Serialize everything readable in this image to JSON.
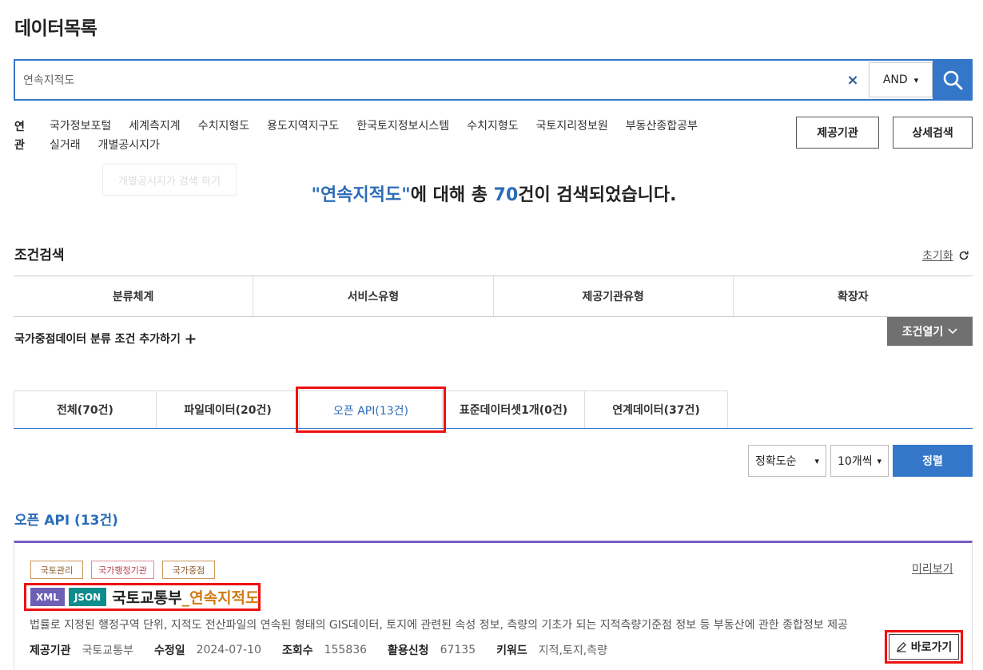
{
  "page": {
    "title": "데이터목록"
  },
  "search": {
    "value": "연속지적도",
    "clear_icon": "×",
    "operator": "AND"
  },
  "related": {
    "label": "연관",
    "items": [
      "국가정보포털",
      "세계측지계",
      "수치지형도",
      "용도지역지구도",
      "한국토지정보시스템",
      "수치지형도",
      "국토지리정보원",
      "부동산종합공부",
      "실거래",
      "개별공시지가"
    ],
    "tooltip": "개별공시지가 검색 하기"
  },
  "buttons": {
    "provider": "제공기관",
    "detail_search": "상세검색"
  },
  "result": {
    "open_quote": "\"",
    "keyword": "연속지적도",
    "close_quote": "\"",
    "mid": "에 대해 총 ",
    "count": "70",
    "suffix": "건이 검색되었습니다."
  },
  "conditions": {
    "title": "조건검색",
    "reset": "초기화",
    "columns": [
      "분류체계",
      "서비스유형",
      "제공기관유형",
      "확장자"
    ],
    "add_label": "국가중점데이터 분류 조건 추가하기",
    "open_label": "조건열기"
  },
  "tabs": [
    {
      "label": "전체(70건)"
    },
    {
      "label": "파일데이터(20건)"
    },
    {
      "label": "오픈 API(13건)"
    },
    {
      "label": "표준데이터셋1개(0건)"
    },
    {
      "label": "연계데이터(37건)"
    }
  ],
  "sort": {
    "order": "정확도순",
    "per_page": "10개씩",
    "button": "정렬"
  },
  "section": {
    "title": "오픈 API (13건)"
  },
  "item": {
    "tags": [
      "국토관리",
      "국가행정기관",
      "국가중점"
    ],
    "preview": "미리보기",
    "formats": [
      "XML",
      "JSON"
    ],
    "title_org": "국토교통부",
    "title_sep": "_",
    "title_name": "연속지적도",
    "description": "법률로 지정된 행정구역 단위, 지적도 전산파일의 연속된 형태의 GIS데이터, 토지에 관련된 속성 정보, 측량의 기초가 되는 지적측량기준점 정보 등 부동산에 관한 종합정보 제공",
    "meta": [
      {
        "key": "제공기관",
        "value": "국토교통부"
      },
      {
        "key": "수정일",
        "value": "2024-07-10"
      },
      {
        "key": "조회수",
        "value": "155836"
      },
      {
        "key": "활용신청",
        "value": "67135"
      },
      {
        "key": "키워드",
        "value": "지적,토지,측량"
      }
    ],
    "goto": "바로가기"
  },
  "colors": {
    "primary": "#3477c8",
    "highlight": "#e11111",
    "purple": "#7a5bc2",
    "orange": "#d07a12"
  }
}
